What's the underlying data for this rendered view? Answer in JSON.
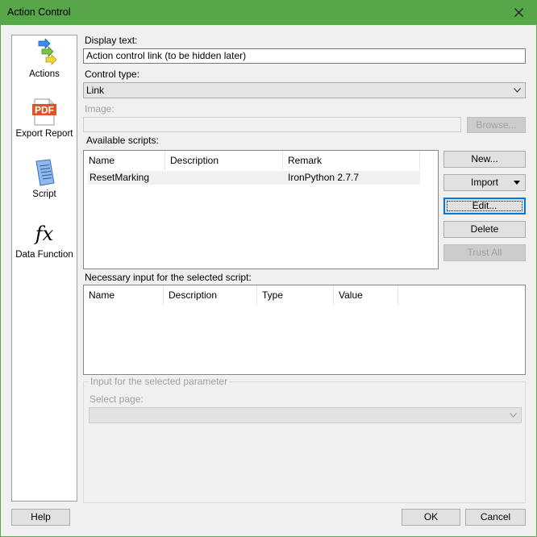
{
  "window": {
    "title": "Action Control",
    "accent": "#57a64a"
  },
  "sidebar": {
    "items": [
      {
        "label": "Actions",
        "icon": "actions-arrows-icon",
        "selected": false
      },
      {
        "label": "Export Report",
        "icon": "pdf-icon",
        "icon_text": "PDF",
        "selected": false
      },
      {
        "label": "Script",
        "icon": "script-icon",
        "selected": true
      },
      {
        "label": "Data Function",
        "icon": "fx-icon",
        "icon_text": "fx",
        "selected": false
      }
    ]
  },
  "form": {
    "display_text_label": "Display text:",
    "display_text_value": "Action control link (to be hidden later)",
    "control_type_label": "Control type:",
    "control_type_value": "Link",
    "image_label": "Image:",
    "image_value": "",
    "browse_label": "Browse...",
    "available_scripts_label": "Available scripts:",
    "scripts_columns": [
      "Name",
      "Description",
      "Remark"
    ],
    "scripts_rows": [
      {
        "name": "ResetMarking",
        "description": "",
        "remark": "IronPython 2.7.7"
      }
    ],
    "necessary_input_label": "Necessary input for the selected script:",
    "input_columns": [
      "Name",
      "Description",
      "Type",
      "Value"
    ],
    "input_rows": [],
    "param_group_label": "Input for the selected parameter",
    "select_page_label": "Select page:",
    "select_page_value": ""
  },
  "script_buttons": {
    "new": "New...",
    "import": "Import",
    "edit": "Edit...",
    "delete": "Delete",
    "trust_all": "Trust All"
  },
  "footer": {
    "help": "Help",
    "ok": "OK",
    "cancel": "Cancel"
  }
}
